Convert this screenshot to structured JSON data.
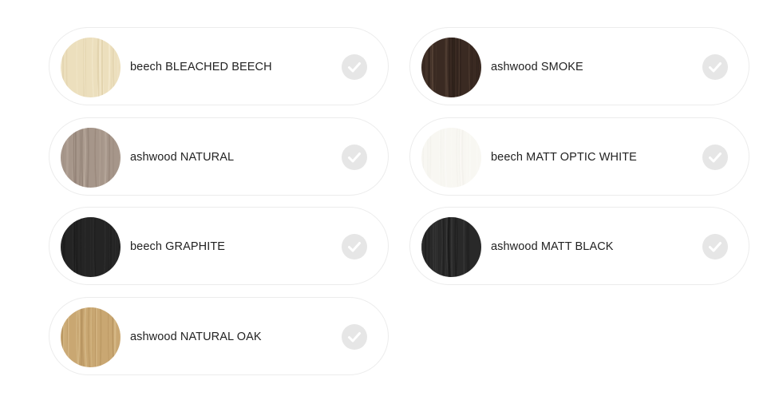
{
  "finishes": [
    {
      "label": "beech BLEACHED BEECH",
      "icon": "wood-swatch-bleached-beech",
      "swatch_base": "#ecdfbd",
      "swatch_grain": "#f6ecd2",
      "swatch_dark": "#ddcda6",
      "check_icon": "check-icon"
    },
    {
      "label": "ashwood SMOKE",
      "icon": "wood-swatch-smoke",
      "swatch_base": "#3a2a22",
      "swatch_grain": "#5a463a",
      "swatch_dark": "#261a15",
      "check_icon": "check-icon"
    },
    {
      "label": "ashwood NATURAL",
      "icon": "wood-swatch-ashwood-natural",
      "swatch_base": "#a6968a",
      "swatch_grain": "#c2b3a6",
      "swatch_dark": "#8c7b6f",
      "check_icon": "check-icon"
    },
    {
      "label": "beech MATT OPTIC WHITE",
      "icon": "wood-swatch-matt-optic-white",
      "swatch_base": "#f8f7f2",
      "swatch_grain": "#fbfaf6",
      "swatch_dark": "#f1f0ea",
      "check_icon": "check-icon"
    },
    {
      "label": "beech GRAPHITE",
      "icon": "wood-swatch-graphite",
      "swatch_base": "#242424",
      "swatch_grain": "#343434",
      "swatch_dark": "#161616",
      "check_icon": "check-icon"
    },
    {
      "label": "ashwood MATT BLACK",
      "icon": "wood-swatch-matt-black",
      "swatch_base": "#292929",
      "swatch_grain": "#454545",
      "swatch_dark": "#151515",
      "check_icon": "check-icon"
    },
    {
      "label": "ashwood NATURAL OAK",
      "icon": "wood-swatch-natural-oak",
      "swatch_base": "#c9a772",
      "swatch_grain": "#d9bd8c",
      "swatch_dark": "#b28f5b",
      "check_icon": "check-icon"
    }
  ],
  "colors": {
    "border": "#ececec",
    "check_bg": "#e6e6e6",
    "check_mark": "#ffffff",
    "text": "#222222"
  }
}
